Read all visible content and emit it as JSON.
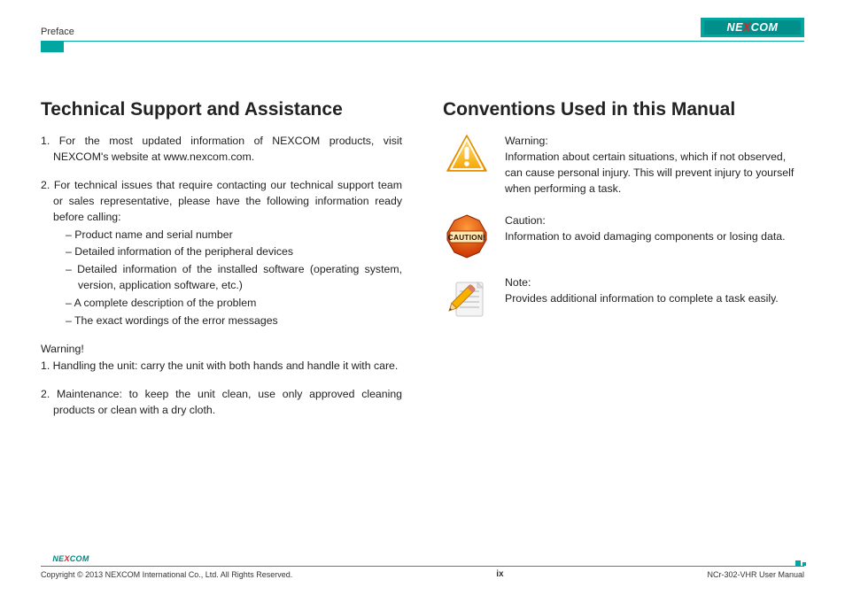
{
  "header": {
    "section": "Preface",
    "logo_text_pre": "NE",
    "logo_text_x": "X",
    "logo_text_post": "COM"
  },
  "left": {
    "heading": "Technical Support and Assistance",
    "item1": "1. For the most updated information of NEXCOM products, visit NEXCOM's website at www.nexcom.com.",
    "item2": "2. For technical issues that require contacting our technical support team or sales representative, please have the following information ready before calling:",
    "sub": [
      "Product name and serial number",
      "Detailed information of the peripheral devices",
      "Detailed information of the installed software (operating system, version, application software, etc.)",
      "A complete description of the problem",
      "The exact wordings of the error messages"
    ],
    "warning_label": "Warning!",
    "w1": "1. Handling the unit: carry the unit with both hands and handle it with care.",
    "w2": "2. Maintenance: to keep the unit clean, use only approved cleaning products or clean with a dry cloth."
  },
  "right": {
    "heading": "Conventions Used in this Manual",
    "warning_title": "Warning:",
    "warning_body": "Information about certain situations, which if not observed, can cause personal injury. This will prevent injury to yourself when performing a task.",
    "caution_title": "Caution:",
    "caution_body": "Information to avoid damaging components or losing data.",
    "note_title": "Note:",
    "note_body": "Provides additional information to complete a task easily."
  },
  "footer": {
    "copyright": "Copyright © 2013 NEXCOM International Co., Ltd. All Rights Reserved.",
    "page": "ix",
    "doc": "NCr-302-VHR User Manual"
  }
}
